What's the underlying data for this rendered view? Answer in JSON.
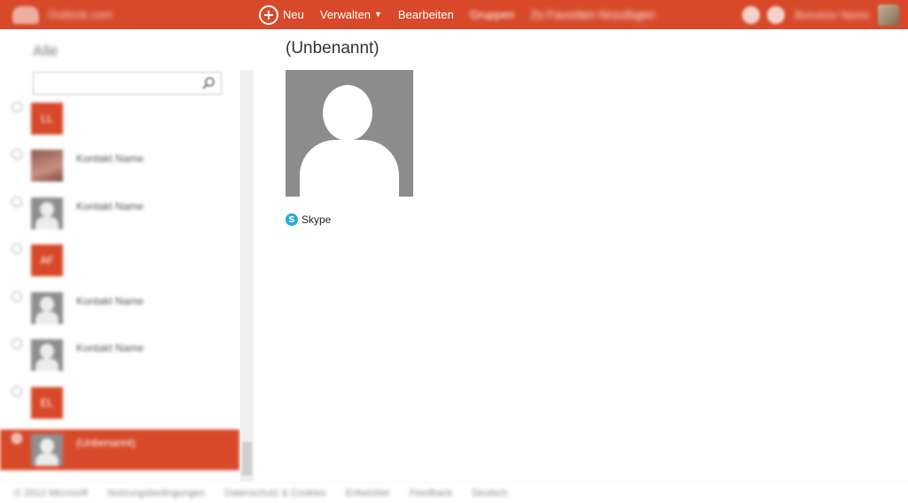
{
  "topbar": {
    "brand_text": "Outlook.com",
    "new_label": "Neu",
    "manage_label": "Verwalten",
    "edit_label": "Bearbeiten",
    "groups_label": "Gruppen",
    "extra_label": "Zu Favoriten hinzufügen",
    "user_name": "Benutzer Name",
    "accent_color": "#d8492a"
  },
  "sidebar": {
    "title": "Alle",
    "search_placeholder": "",
    "items": [
      {
        "type": "red",
        "initials": "LL",
        "name": ""
      },
      {
        "type": "photo",
        "initials": "",
        "name": "Kontakt Name"
      },
      {
        "type": "person",
        "initials": "",
        "name": "Kontakt Name"
      },
      {
        "type": "red",
        "initials": "AF",
        "name": ""
      },
      {
        "type": "person",
        "initials": "",
        "name": "Kontakt Name"
      },
      {
        "type": "person",
        "initials": "",
        "name": "Kontakt Name"
      },
      {
        "type": "red",
        "initials": "EL",
        "name": ""
      },
      {
        "type": "person",
        "initials": "",
        "name": "(Unbenannt)"
      }
    ],
    "selected_index": 7
  },
  "contact": {
    "name": "(Unbenannt)",
    "skype_label": "Skype",
    "skype_icon_glyph": "S"
  },
  "footer": {
    "links": [
      "© 2013 Microsoft",
      "Nutzungsbedingungen",
      "Datenschutz & Cookies",
      "Entwickler",
      "Feedback",
      "Deutsch"
    ]
  }
}
